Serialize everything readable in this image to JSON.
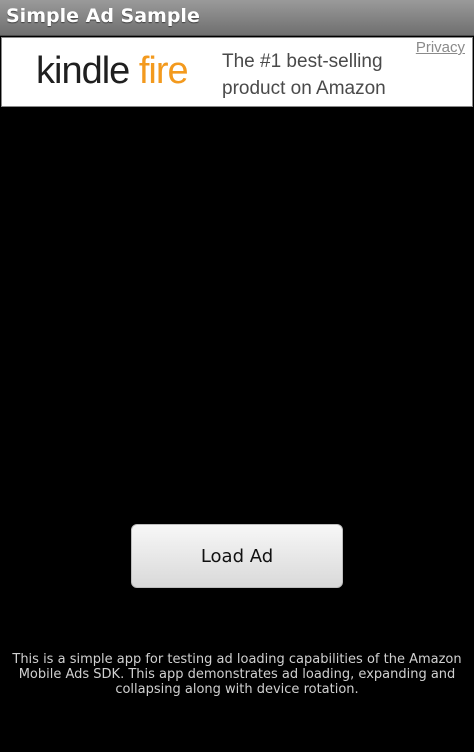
{
  "app": {
    "title": "Simple Ad Sample"
  },
  "ad": {
    "logo_kindle": "kindle",
    "logo_fire": "fire",
    "tagline_line1": "The #1 best-selling",
    "tagline_line2": "product on Amazon",
    "privacy_label": "Privacy",
    "colors": {
      "fire": "#f39a1e",
      "kindle": "#1f1f1f"
    }
  },
  "main": {
    "load_button_label": "Load Ad",
    "description_lines": [
      "This is a simple app for testing ad loading capabilities of the Amazon",
      "Mobile Ads SDK. This app demonstrates ad loading, expanding and",
      "collapsing along with device rotation."
    ]
  }
}
